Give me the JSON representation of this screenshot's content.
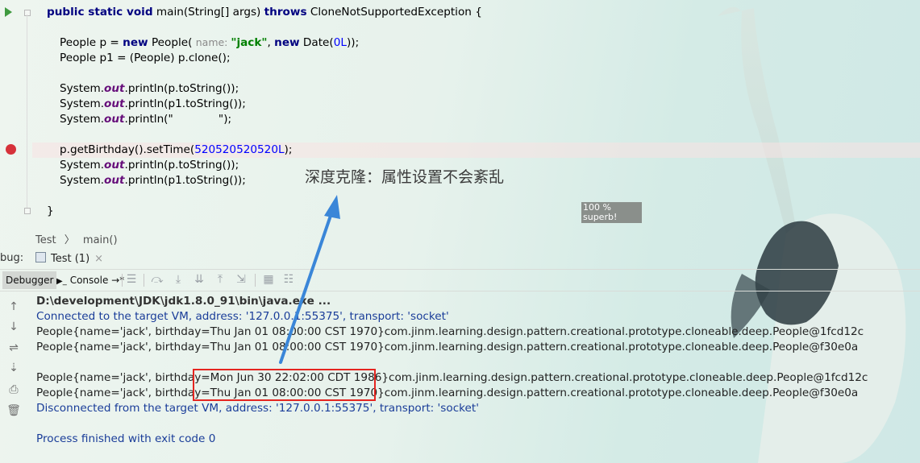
{
  "editor": {
    "lines": {
      "l1_kw1": "public static void",
      "l1_mid": " main(String[] args) ",
      "l1_kw2": "throws",
      "l1_end": " CloneNotSupportedException {",
      "l2_a": "People p = ",
      "l2_kw": "new",
      "l2_b": " People( ",
      "l2_hint": "name: ",
      "l2_str": "\"jack\"",
      "l2_c": ", ",
      "l2_kw2": "new",
      "l2_d": " Date(",
      "l2_num": "0L",
      "l2_e": "));",
      "l3": "People p1 = (People) p.clone();",
      "l4_a": "System.",
      "l4_out": "out",
      "l4_b": ".println(p.toString());",
      "l5_a": "System.",
      "l5_out": "out",
      "l5_b": ".println(p1.toString());",
      "l6_a": "System.",
      "l6_out": "out",
      "l6_b": ".println(\"",
      "l6_str": "             \"",
      "l6_c": ");",
      "l7_a": "p.getBirthday().setTime(",
      "l7_num": "520520520520L",
      "l7_b": ");",
      "l8_a": "System.",
      "l8_out": "out",
      "l8_b": ".println(p.toString());",
      "l9_a": "System.",
      "l9_out": "out",
      "l9_b": ".println(p1.toString());",
      "l10": "}"
    },
    "annotation": "深度克隆：属性设置不会紊乱",
    "badge_line1": "100 %",
    "badge_line2": "superb!"
  },
  "breadcrumb": [
    "Test",
    "main()"
  ],
  "debug_tabs": {
    "prefix": "bug:",
    "test_tab": "Test (1)",
    "close": "×"
  },
  "toolbar": {
    "debugger": "Debugger",
    "console": "Console",
    "console_suffix": "→*"
  },
  "console": {
    "cmd": "D:\\development\\JDK\\jdk1.8.0_91\\bin\\java.exe ...",
    "connected": "Connected to the target VM, address: '127.0.0.1:55375', transport: 'socket'",
    "out1": "People{name='jack', birthday=Thu Jan 01 08:00:00 CST 1970}com.jinm.learning.design.pattern.creational.prototype.cloneable.deep.People@1fcd12c",
    "out2": "People{name='jack', birthday=Thu Jan 01 08:00:00 CST 1970}com.jinm.learning.design.pattern.creational.prototype.cloneable.deep.People@f30e0a",
    "out3": "People{name='jack', birthday=Mon Jun 30 22:02:00 CDT 1986}com.jinm.learning.design.pattern.creational.prototype.cloneable.deep.People@1fcd12c",
    "out4": "People{name='jack', birthday=Thu Jan 01 08:00:00 CST 1970}com.jinm.learning.design.pattern.creational.prototype.cloneable.deep.People@f30e0a",
    "disconnected": "Disconnected from the target VM, address: '127.0.0.1:55375', transport: 'socket'",
    "finished": "Process finished with exit code 0"
  },
  "colors": {
    "keyword": "#000080",
    "string": "#008000",
    "number": "#0000ff",
    "static_field": "#660e7a",
    "console_info": "#1a3d99",
    "highlight_box": "#e52520",
    "breakpoint": "#d6313a",
    "arrow": "#3a86d8"
  },
  "icons": {
    "run": "run-arrow-icon",
    "breakpoint": "breakpoint-icon",
    "up": "arrow-up-icon",
    "down": "arrow-down-icon",
    "wrap": "soft-wrap-icon",
    "scroll_end": "scroll-to-end-icon",
    "print": "print-icon",
    "trash": "trash-icon"
  }
}
